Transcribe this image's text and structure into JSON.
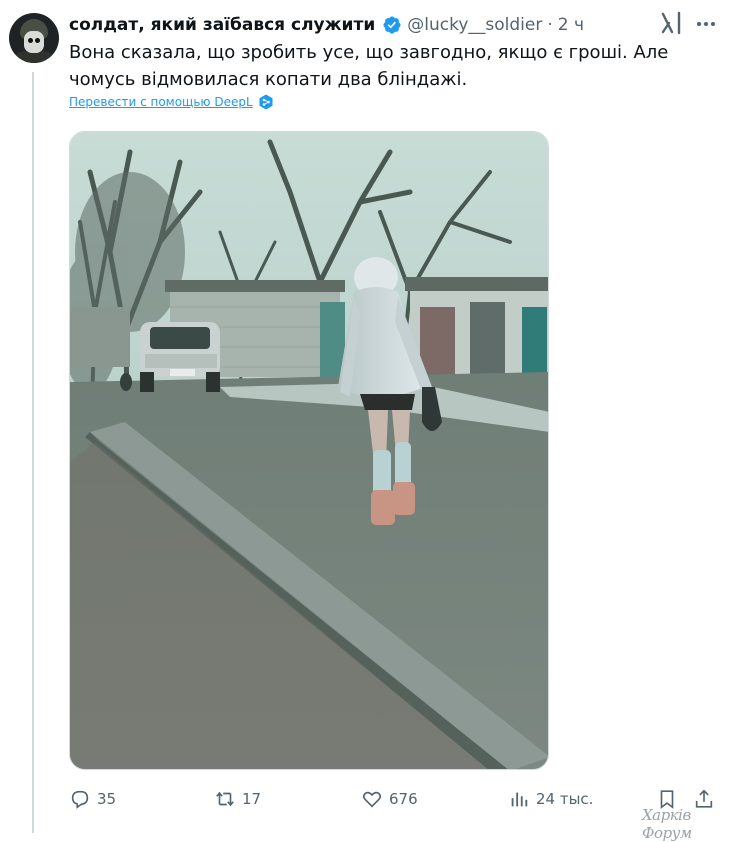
{
  "tweet": {
    "display_name": "солдат, який заїбався служити",
    "handle": "@lucky__soldier",
    "separator": "·",
    "time": "2 ч",
    "text": "Вона сказала, що зробить усе, що завгодно, якщо є гроші. Але чомусь відмовилася копати два бліндажі.",
    "translate_link": "Перевести с помощью DeepL"
  },
  "actions": {
    "replies": "35",
    "reposts": "17",
    "likes": "676",
    "views": "24 тыс."
  },
  "watermark": "Харків Форум",
  "colors": {
    "accent": "#1d9bf0",
    "muted": "#536471",
    "text": "#0f1419",
    "divider": "#cfd9de"
  },
  "icons": [
    "avatar",
    "verified-badge-icon",
    "grok-icon",
    "more-icon",
    "deepl-icon",
    "reply-icon",
    "repost-icon",
    "like-icon",
    "views-icon",
    "bookmark-icon",
    "share-icon"
  ]
}
